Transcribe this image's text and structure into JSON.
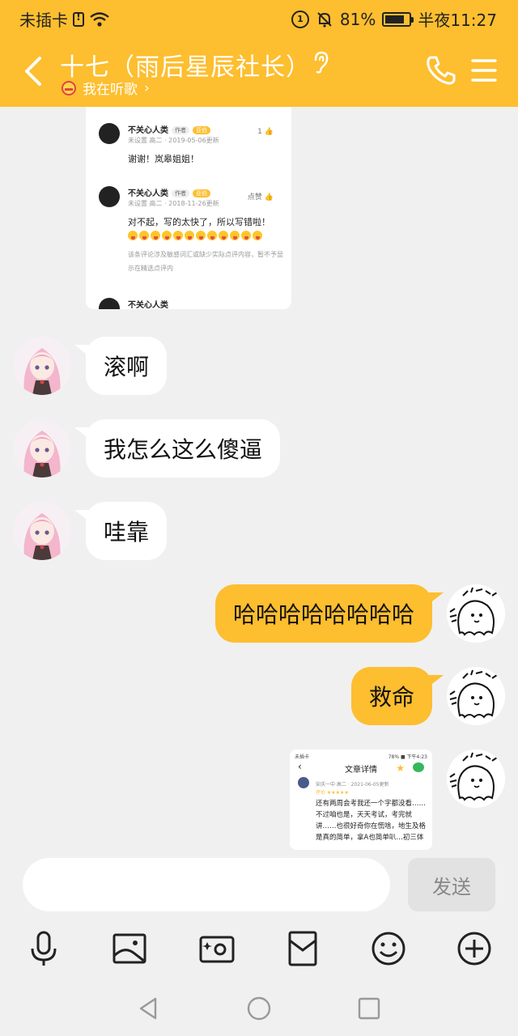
{
  "status_bar": {
    "carrier": "未插卡",
    "battery": "81%",
    "battery_level": 0.81,
    "time": "半夜11:27",
    "hd_label": "1"
  },
  "header": {
    "title": "十七（雨后星辰社长）",
    "subtitle": "我在听歌",
    "chevron": "›",
    "bg_color": "#fdbe2f"
  },
  "screenshot_1": {
    "comments": [
      {
        "name": "不关心人类",
        "tag_author": "作者",
        "tag_badge": "亚伯",
        "meta": "未设置 高二 · 2019-05-06更新",
        "like": "1",
        "body": "谢谢！岚皋姐姐！"
      },
      {
        "name": "不关心人类",
        "tag_author": "作者",
        "tag_badge": "亚伯",
        "meta": "未设置 高二 · 2018-11-26更新",
        "like": "点赞",
        "body": "对不起，写的太快了，所以写错啦！",
        "note": "该条评论涉及敏感词汇或缺少实际点评内容，暂不予显示在精选点评内"
      }
    ],
    "cut_name": "不关心人类"
  },
  "messages": [
    {
      "side": "in",
      "text": "滚啊"
    },
    {
      "side": "in",
      "text": "我怎么这么傻逼"
    },
    {
      "side": "in",
      "text": "哇靠"
    },
    {
      "side": "out",
      "text": "哈哈哈哈哈哈哈哈"
    },
    {
      "side": "out",
      "text": "救命"
    }
  ],
  "screenshot_2": {
    "status_left": "未插卡",
    "status_right": "78% ■ 下午4:23",
    "header": "文章详情",
    "meta": "安庆一中 高二 · 2021-06-05更新",
    "rating": "评价 ★★★★★",
    "text": "还有两周会考我还一个字都没看……不过咱也是，天天考试，考完就讲……也很好奇你在慌啥，地生及格是真的简单，拿A也简单叭…初三体"
  },
  "input": {
    "placeholder": "",
    "send_label": "发送"
  },
  "toolbar": {
    "icons": [
      "microphone-icon",
      "image-icon",
      "camera-icon",
      "red-packet-icon",
      "emoji-icon",
      "plus-icon"
    ]
  },
  "navbar": {
    "icons": [
      "back-triangle-icon",
      "home-circle-icon",
      "recent-square-icon"
    ]
  }
}
